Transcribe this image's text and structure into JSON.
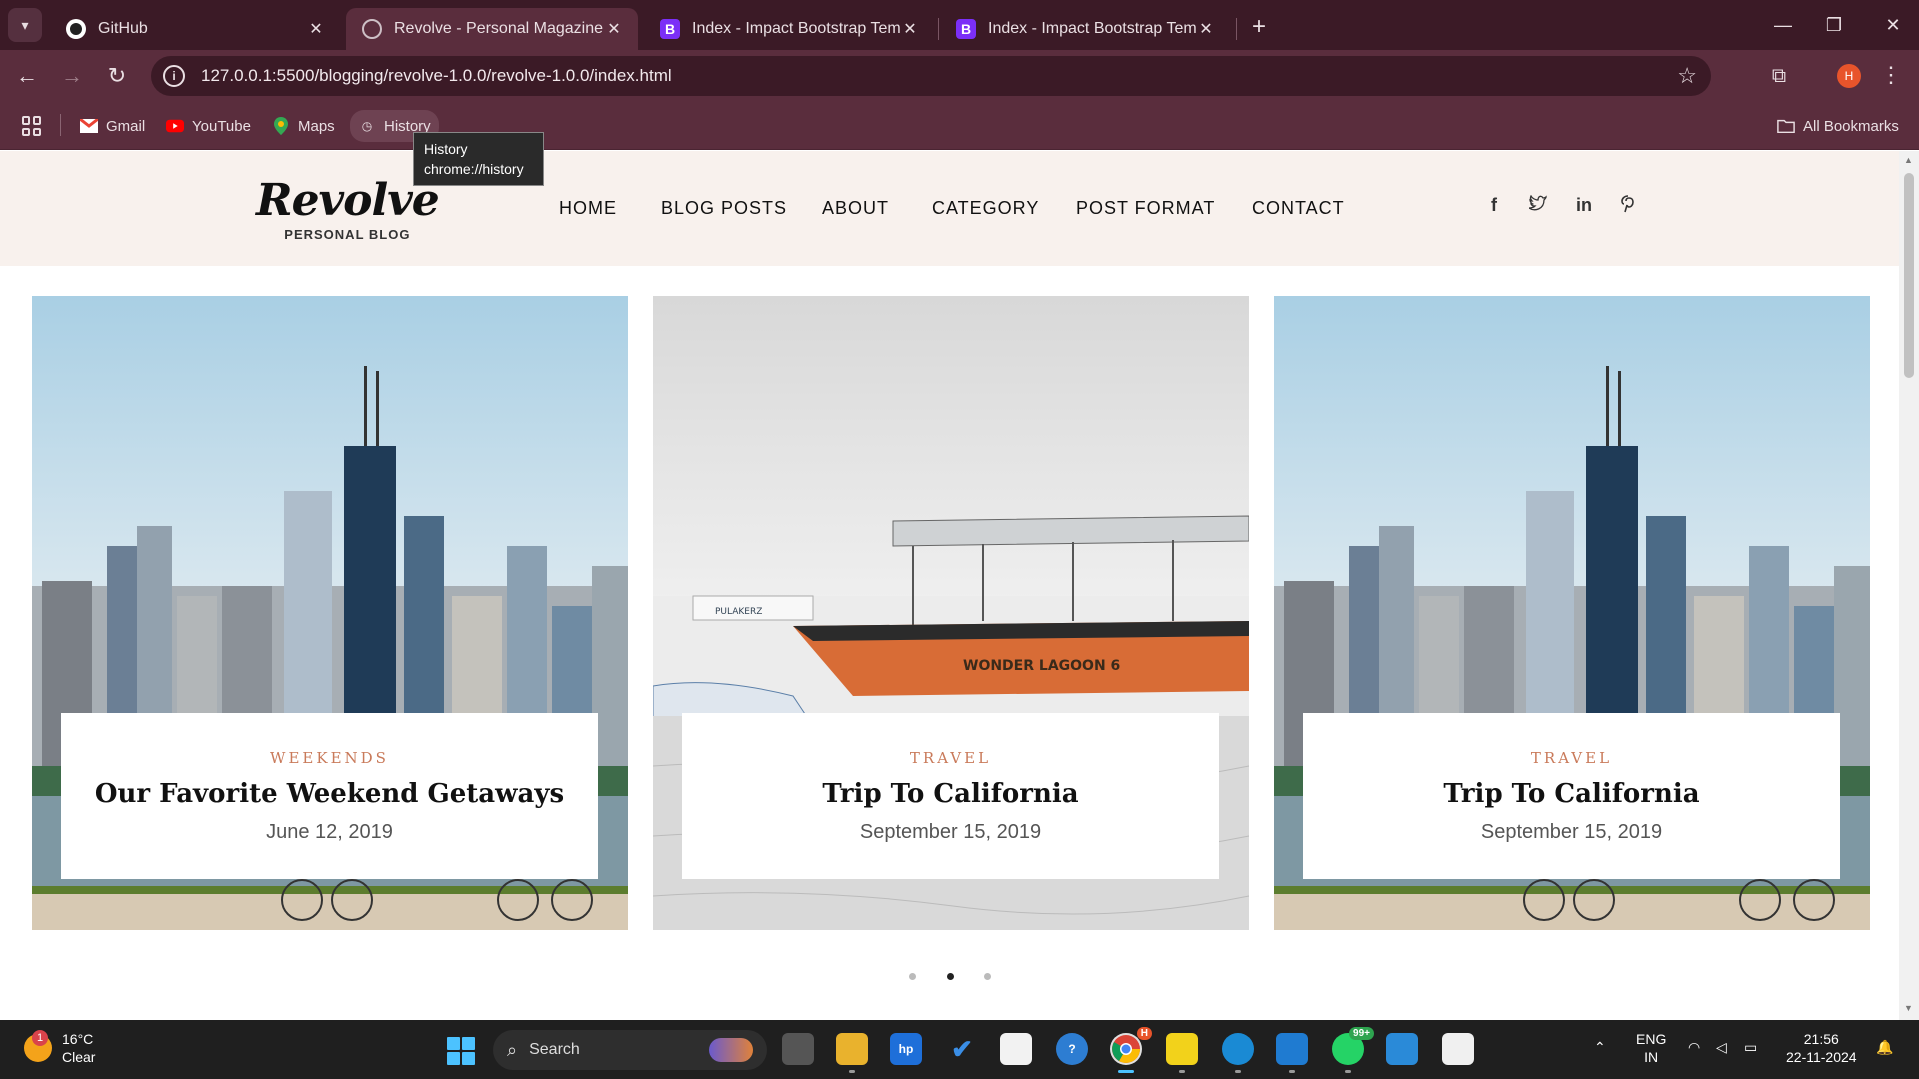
{
  "browser": {
    "tabs": [
      {
        "title": "GitHub",
        "icon": "github-icon"
      },
      {
        "title": "Revolve - Personal Magazine bl",
        "icon": "globe-icon"
      },
      {
        "title": "Index - Impact Bootstrap Templ",
        "icon": "bootstrap-icon"
      },
      {
        "title": "Index - Impact Bootstrap Templ",
        "icon": "bootstrap-icon"
      }
    ],
    "bootstrap_letter": "B",
    "url": "127.0.0.1:5500/blogging/revolve-1.0.0/revolve-1.0.0/index.html",
    "profile_initial": "H",
    "bookmarks": [
      {
        "label": "Gmail"
      },
      {
        "label": "YouTube"
      },
      {
        "label": "Maps"
      },
      {
        "label": "History"
      }
    ],
    "all_bookmarks": "All Bookmarks",
    "tooltip": {
      "line1": "History",
      "line2": "chrome://history"
    }
  },
  "site": {
    "logo_name": "Revolve",
    "logo_tagline": "PERSONAL BLOG",
    "nav": [
      "HOME",
      "BLOG POSTS",
      "ABOUT",
      "CATEGORY",
      "POST FORMAT",
      "CONTACT"
    ],
    "social": [
      {
        "glyph": "f",
        "icon": "facebook-icon"
      },
      {
        "glyph": "t",
        "icon": "twitter-icon"
      },
      {
        "glyph": "in",
        "icon": "linkedin-icon"
      },
      {
        "glyph": "p",
        "icon": "pinterest-icon"
      }
    ],
    "slides": [
      {
        "category": "WEEKENDS",
        "title": "Our Favorite Weekend Getaways",
        "date": "June 12, 2019",
        "image": "city-skyline"
      },
      {
        "category": "TRAVEL",
        "title": "Trip To California",
        "date": "September 15, 2019",
        "image": "boat-lagoon"
      },
      {
        "category": "TRAVEL",
        "title": "Trip To California",
        "date": "September 15, 2019",
        "image": "city-skyline"
      }
    ],
    "boat_text": "WONDER LAGOON 6",
    "boat2_text": "PULAKERZ",
    "carousel_active_index": 1,
    "accent_color": "#c97a5a"
  },
  "taskbar": {
    "weather_badge": "1",
    "temperature": "16°C",
    "condition": "Clear",
    "search_label": "Search",
    "whatsapp_badge": "99+",
    "chrome_badge": "H",
    "lang_top": "ENG",
    "lang_bottom": "IN",
    "time": "21:56",
    "date": "22-11-2024"
  }
}
